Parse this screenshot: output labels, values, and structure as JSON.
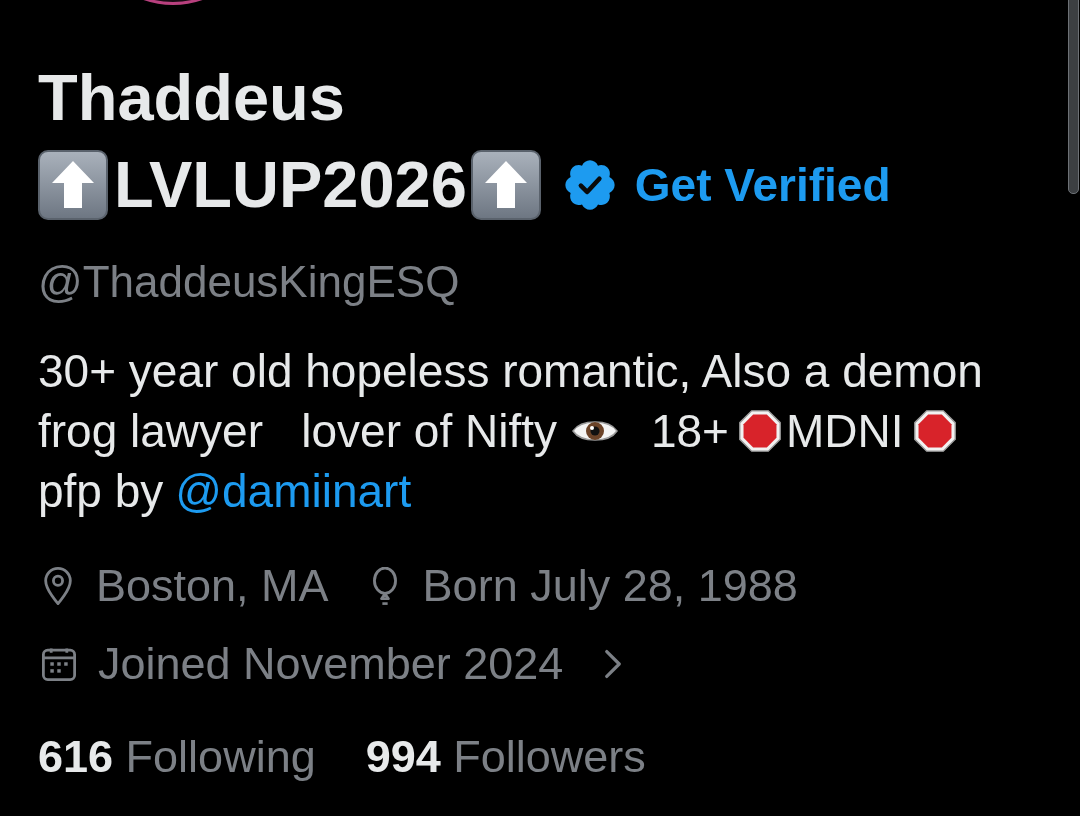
{
  "profile": {
    "name_line1": "Thaddeus",
    "name_line2": [
      {
        "kind": "arrow"
      },
      {
        "kind": "text",
        "text": "LVLUP2026"
      },
      {
        "kind": "arrow"
      }
    ],
    "verified": true,
    "get_verified": "Get Verified",
    "handle": "@ThaddeusKingESQ",
    "bio": [
      [
        {
          "kind": "text",
          "text": "30+ year old hopeless romantic, Also a demon"
        }
      ],
      [
        {
          "kind": "text",
          "text": "frog lawyer   lover of Nifty"
        },
        {
          "kind": "eye"
        },
        {
          "kind": "text",
          "text": "18+"
        },
        {
          "kind": "stop"
        },
        {
          "kind": "text",
          "text": "MDNI"
        },
        {
          "kind": "stop"
        }
      ],
      [
        {
          "kind": "text",
          "text": "pfp by"
        },
        {
          "kind": "link",
          "text": "@damiinart"
        }
      ]
    ],
    "meta": [
      [
        {
          "kind": "location",
          "text": "Boston, MA"
        },
        {
          "kind": "birthday",
          "text": "Born July 28, 1988"
        }
      ],
      [
        {
          "kind": "joined",
          "text": "Joined November 2024"
        }
      ]
    ],
    "stats": [
      {
        "count": "616",
        "label": "Following"
      },
      {
        "count": "994",
        "label": "Followers"
      }
    ]
  }
}
